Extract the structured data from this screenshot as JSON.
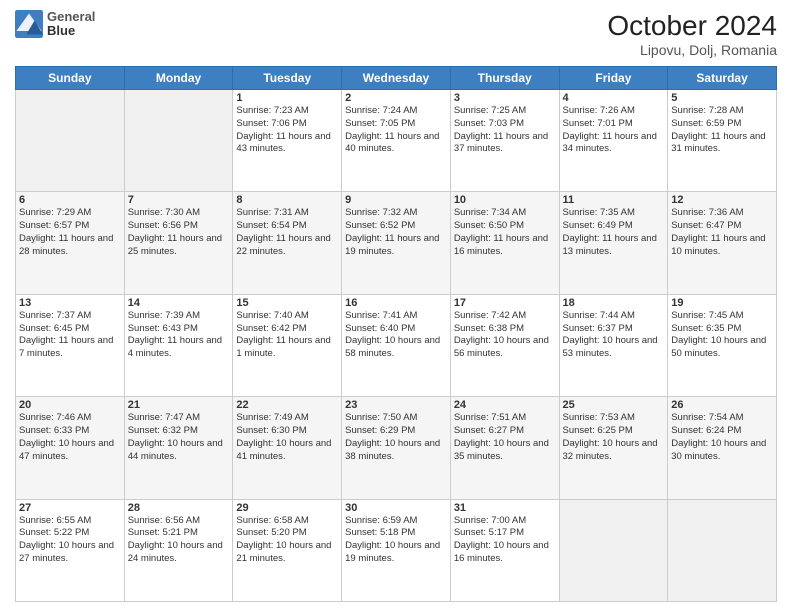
{
  "logo": {
    "line1": "General",
    "line2": "Blue"
  },
  "title": "October 2024",
  "subtitle": "Lipovu, Dolj, Romania",
  "days_of_week": [
    "Sunday",
    "Monday",
    "Tuesday",
    "Wednesday",
    "Thursday",
    "Friday",
    "Saturday"
  ],
  "weeks": [
    [
      {
        "day": "",
        "detail": ""
      },
      {
        "day": "",
        "detail": ""
      },
      {
        "day": "1",
        "detail": "Sunrise: 7:23 AM\nSunset: 7:06 PM\nDaylight: 11 hours and 43 minutes."
      },
      {
        "day": "2",
        "detail": "Sunrise: 7:24 AM\nSunset: 7:05 PM\nDaylight: 11 hours and 40 minutes."
      },
      {
        "day": "3",
        "detail": "Sunrise: 7:25 AM\nSunset: 7:03 PM\nDaylight: 11 hours and 37 minutes."
      },
      {
        "day": "4",
        "detail": "Sunrise: 7:26 AM\nSunset: 7:01 PM\nDaylight: 11 hours and 34 minutes."
      },
      {
        "day": "5",
        "detail": "Sunrise: 7:28 AM\nSunset: 6:59 PM\nDaylight: 11 hours and 31 minutes."
      }
    ],
    [
      {
        "day": "6",
        "detail": "Sunrise: 7:29 AM\nSunset: 6:57 PM\nDaylight: 11 hours and 28 minutes."
      },
      {
        "day": "7",
        "detail": "Sunrise: 7:30 AM\nSunset: 6:56 PM\nDaylight: 11 hours and 25 minutes."
      },
      {
        "day": "8",
        "detail": "Sunrise: 7:31 AM\nSunset: 6:54 PM\nDaylight: 11 hours and 22 minutes."
      },
      {
        "day": "9",
        "detail": "Sunrise: 7:32 AM\nSunset: 6:52 PM\nDaylight: 11 hours and 19 minutes."
      },
      {
        "day": "10",
        "detail": "Sunrise: 7:34 AM\nSunset: 6:50 PM\nDaylight: 11 hours and 16 minutes."
      },
      {
        "day": "11",
        "detail": "Sunrise: 7:35 AM\nSunset: 6:49 PM\nDaylight: 11 hours and 13 minutes."
      },
      {
        "day": "12",
        "detail": "Sunrise: 7:36 AM\nSunset: 6:47 PM\nDaylight: 11 hours and 10 minutes."
      }
    ],
    [
      {
        "day": "13",
        "detail": "Sunrise: 7:37 AM\nSunset: 6:45 PM\nDaylight: 11 hours and 7 minutes."
      },
      {
        "day": "14",
        "detail": "Sunrise: 7:39 AM\nSunset: 6:43 PM\nDaylight: 11 hours and 4 minutes."
      },
      {
        "day": "15",
        "detail": "Sunrise: 7:40 AM\nSunset: 6:42 PM\nDaylight: 11 hours and 1 minute."
      },
      {
        "day": "16",
        "detail": "Sunrise: 7:41 AM\nSunset: 6:40 PM\nDaylight: 10 hours and 58 minutes."
      },
      {
        "day": "17",
        "detail": "Sunrise: 7:42 AM\nSunset: 6:38 PM\nDaylight: 10 hours and 56 minutes."
      },
      {
        "day": "18",
        "detail": "Sunrise: 7:44 AM\nSunset: 6:37 PM\nDaylight: 10 hours and 53 minutes."
      },
      {
        "day": "19",
        "detail": "Sunrise: 7:45 AM\nSunset: 6:35 PM\nDaylight: 10 hours and 50 minutes."
      }
    ],
    [
      {
        "day": "20",
        "detail": "Sunrise: 7:46 AM\nSunset: 6:33 PM\nDaylight: 10 hours and 47 minutes."
      },
      {
        "day": "21",
        "detail": "Sunrise: 7:47 AM\nSunset: 6:32 PM\nDaylight: 10 hours and 44 minutes."
      },
      {
        "day": "22",
        "detail": "Sunrise: 7:49 AM\nSunset: 6:30 PM\nDaylight: 10 hours and 41 minutes."
      },
      {
        "day": "23",
        "detail": "Sunrise: 7:50 AM\nSunset: 6:29 PM\nDaylight: 10 hours and 38 minutes."
      },
      {
        "day": "24",
        "detail": "Sunrise: 7:51 AM\nSunset: 6:27 PM\nDaylight: 10 hours and 35 minutes."
      },
      {
        "day": "25",
        "detail": "Sunrise: 7:53 AM\nSunset: 6:25 PM\nDaylight: 10 hours and 32 minutes."
      },
      {
        "day": "26",
        "detail": "Sunrise: 7:54 AM\nSunset: 6:24 PM\nDaylight: 10 hours and 30 minutes."
      }
    ],
    [
      {
        "day": "27",
        "detail": "Sunrise: 6:55 AM\nSunset: 5:22 PM\nDaylight: 10 hours and 27 minutes."
      },
      {
        "day": "28",
        "detail": "Sunrise: 6:56 AM\nSunset: 5:21 PM\nDaylight: 10 hours and 24 minutes."
      },
      {
        "day": "29",
        "detail": "Sunrise: 6:58 AM\nSunset: 5:20 PM\nDaylight: 10 hours and 21 minutes."
      },
      {
        "day": "30",
        "detail": "Sunrise: 6:59 AM\nSunset: 5:18 PM\nDaylight: 10 hours and 19 minutes."
      },
      {
        "day": "31",
        "detail": "Sunrise: 7:00 AM\nSunset: 5:17 PM\nDaylight: 10 hours and 16 minutes."
      },
      {
        "day": "",
        "detail": ""
      },
      {
        "day": "",
        "detail": ""
      }
    ]
  ]
}
